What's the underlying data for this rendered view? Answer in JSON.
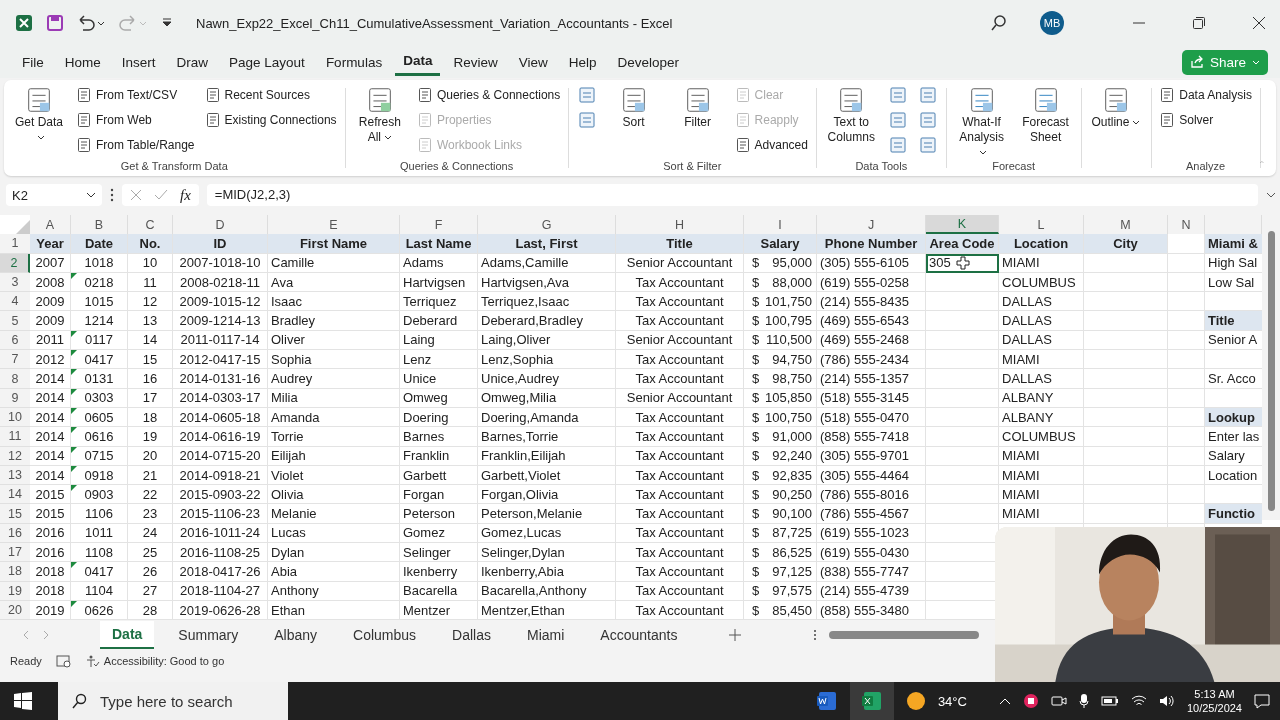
{
  "window": {
    "title": "Nawn_Exp22_Excel_Ch11_CumulativeAssessment_Variation_Accountants  -  Excel",
    "avatar": "MB"
  },
  "menu_tabs": [
    {
      "label": "File",
      "selected": false
    },
    {
      "label": "Home",
      "selected": false
    },
    {
      "label": "Insert",
      "selected": false
    },
    {
      "label": "Draw",
      "selected": false
    },
    {
      "label": "Page Layout",
      "selected": false
    },
    {
      "label": "Formulas",
      "selected": false
    },
    {
      "label": "Data",
      "selected": true
    },
    {
      "label": "Review",
      "selected": false
    },
    {
      "label": "View",
      "selected": false
    },
    {
      "label": "Help",
      "selected": false
    },
    {
      "label": "Developer",
      "selected": false
    }
  ],
  "share_button": "Share",
  "ribbon": [
    {
      "label": "Get & Transform Data",
      "items": [
        {
          "kind": "large",
          "label": "Get Data",
          "dropdown": true,
          "disabled": false
        },
        {
          "kind": "small",
          "label": "From Text/CSV",
          "disabled": false
        },
        {
          "kind": "small",
          "label": "From Web",
          "disabled": false
        },
        {
          "kind": "small",
          "label": "From Table/Range",
          "disabled": false
        },
        {
          "kind": "small",
          "label": "Recent Sources",
          "disabled": false
        },
        {
          "kind": "small",
          "label": "Existing Connections",
          "disabled": false
        }
      ]
    },
    {
      "label": "Queries & Connections",
      "items": [
        {
          "kind": "large",
          "label": "Refresh All",
          "dropdown": true,
          "disabled": false
        },
        {
          "kind": "small",
          "label": "Queries & Connections",
          "disabled": false
        },
        {
          "kind": "small",
          "label": "Properties",
          "disabled": true
        },
        {
          "kind": "small",
          "label": "Workbook Links",
          "disabled": true
        }
      ]
    },
    {
      "label": "Sort & Filter",
      "items": [
        {
          "kind": "icon",
          "disabled": false
        },
        {
          "kind": "icon",
          "disabled": false
        },
        {
          "kind": "large",
          "label": "Sort",
          "dropdown": false,
          "disabled": false
        },
        {
          "kind": "large",
          "label": "Filter",
          "dropdown": false,
          "disabled": false
        },
        {
          "kind": "small",
          "label": "Clear",
          "disabled": true
        },
        {
          "kind": "small",
          "label": "Reapply",
          "disabled": true
        },
        {
          "kind": "small",
          "label": "Advanced",
          "disabled": false
        }
      ]
    },
    {
      "label": "Data Tools",
      "items": [
        {
          "kind": "large",
          "label": "Text to Columns",
          "dropdown": false,
          "disabled": false
        },
        {
          "kind": "icon",
          "disabled": false
        },
        {
          "kind": "icon",
          "disabled": false
        },
        {
          "kind": "icon",
          "disabled": false
        },
        {
          "kind": "icon",
          "disabled": false
        },
        {
          "kind": "icon",
          "disabled": false
        },
        {
          "kind": "icon",
          "disabled": false
        }
      ]
    },
    {
      "label": "Forecast",
      "items": [
        {
          "kind": "large",
          "label": "What-If Analysis",
          "dropdown": true,
          "disabled": false
        },
        {
          "kind": "large",
          "label": "Forecast Sheet",
          "dropdown": false,
          "disabled": false
        }
      ]
    },
    {
      "items": [
        {
          "kind": "large",
          "label": "Outline",
          "dropdown": true,
          "disabled": false
        }
      ]
    },
    {
      "label": "Analyze",
      "items": [
        {
          "kind": "small",
          "label": "Data Analysis",
          "disabled": false
        },
        {
          "kind": "small",
          "label": "Solver",
          "disabled": false
        }
      ]
    }
  ],
  "formula_bar": {
    "name_box": "K2",
    "function_label": "fx",
    "formula": "=MID(J2,2,3)"
  },
  "columns": [
    {
      "letter": "A",
      "label": "Year",
      "selected": false
    },
    {
      "letter": "B",
      "label": "Date",
      "selected": false
    },
    {
      "letter": "C",
      "label": "No.",
      "selected": false
    },
    {
      "letter": "D",
      "label": "ID",
      "selected": false
    },
    {
      "letter": "E",
      "label": "First Name",
      "selected": false
    },
    {
      "letter": "F",
      "label": "Last Name",
      "selected": false
    },
    {
      "letter": "G",
      "label": "Last, First",
      "selected": false
    },
    {
      "letter": "H",
      "label": "Title",
      "selected": false
    },
    {
      "letter": "I",
      "label": "Salary",
      "selected": false
    },
    {
      "letter": "J",
      "label": "Phone Number",
      "selected": false
    },
    {
      "letter": "K",
      "label": "Area Code",
      "selected": true
    },
    {
      "letter": "L",
      "label": "Location",
      "selected": false
    },
    {
      "letter": "M",
      "label": "City",
      "selected": false
    },
    {
      "letter": "N",
      "selected": false
    }
  ],
  "header_row": "1",
  "header_side": "Miami &",
  "rows": [
    {
      "num": "2",
      "selected": true,
      "flag": false,
      "year": "2007",
      "date": "1018",
      "no": "10",
      "id": "2007-1018-10",
      "first": "Camille",
      "last": "Adams",
      "lastfirst": "Adams,Camille",
      "title": "Senior Accountant",
      "currency": "$",
      "salary": "95,000",
      "phone": "(305) 555-6105",
      "area": "305",
      "location": "MIAMI",
      "side": {
        "kind": "text",
        "text": "High Sal"
      }
    },
    {
      "num": "3",
      "selected": false,
      "flag": true,
      "year": "2008",
      "date": "0218",
      "no": "11",
      "id": "2008-0218-11",
      "first": "Ava",
      "last": "Hartvigsen",
      "lastfirst": "Hartvigsen,Ava",
      "title": "Tax Accountant",
      "currency": "$",
      "salary": "88,000",
      "phone": "(619) 555-0258",
      "location": "COLUMBUS",
      "side": {
        "kind": "text",
        "text": "Low Sal"
      }
    },
    {
      "num": "4",
      "selected": false,
      "flag": false,
      "year": "2009",
      "date": "1015",
      "no": "12",
      "id": "2009-1015-12",
      "first": "Isaac",
      "last": "Terriquez",
      "lastfirst": "Terriquez,Isaac",
      "title": "Tax Accountant",
      "currency": "$",
      "salary": "101,750",
      "phone": "(214) 555-8435",
      "location": "DALLAS"
    },
    {
      "num": "5",
      "selected": false,
      "flag": false,
      "year": "2009",
      "date": "1214",
      "no": "13",
      "id": "2009-1214-13",
      "first": "Bradley",
      "last": "Deberard",
      "lastfirst": "Deberard,Bradley",
      "title": "Tax Accountant",
      "currency": "$",
      "salary": "100,795",
      "phone": "(469) 555-6543",
      "location": "DALLAS",
      "side": {
        "kind": "heading",
        "text": "Title"
      }
    },
    {
      "num": "6",
      "selected": false,
      "flag": true,
      "year": "2011",
      "date": "0117",
      "no": "14",
      "id": "2011-0117-14",
      "first": "Oliver",
      "last": "Laing",
      "lastfirst": "Laing,Oliver",
      "title": "Senior Accountant",
      "currency": "$",
      "salary": "110,500",
      "phone": "(469) 555-2468",
      "location": "DALLAS",
      "side": {
        "kind": "text",
        "text": "Senior A"
      }
    },
    {
      "num": "7",
      "selected": false,
      "flag": true,
      "year": "2012",
      "date": "0417",
      "no": "15",
      "id": "2012-0417-15",
      "first": "Sophia",
      "last": "Lenz",
      "lastfirst": "Lenz,Sophia",
      "title": "Tax Accountant",
      "currency": "$",
      "salary": "94,750",
      "phone": "(786) 555-2434",
      "location": "MIAMI"
    },
    {
      "num": "8",
      "selected": false,
      "flag": true,
      "year": "2014",
      "date": "0131",
      "no": "16",
      "id": "2014-0131-16",
      "first": "Audrey",
      "last": "Unice",
      "lastfirst": "Unice,Audrey",
      "title": "Tax Accountant",
      "currency": "$",
      "salary": "98,750",
      "phone": "(214) 555-1357",
      "location": "DALLAS",
      "side": {
        "kind": "text",
        "text": "Sr. Acco"
      }
    },
    {
      "num": "9",
      "selected": false,
      "flag": true,
      "year": "2014",
      "date": "0303",
      "no": "17",
      "id": "2014-0303-17",
      "first": "Milia",
      "last": "Omweg",
      "lastfirst": "Omweg,Milia",
      "title": "Senior Accountant",
      "currency": "$",
      "salary": "105,850",
      "phone": "(518) 555-3145",
      "location": "ALBANY"
    },
    {
      "num": "10",
      "selected": false,
      "flag": true,
      "year": "2014",
      "date": "0605",
      "no": "18",
      "id": "2014-0605-18",
      "first": "Amanda",
      "last": "Doering",
      "lastfirst": "Doering,Amanda",
      "title": "Tax Accountant",
      "currency": "$",
      "salary": "100,750",
      "phone": "(518) 555-0470",
      "location": "ALBANY",
      "side": {
        "kind": "heading",
        "text": "Lookup"
      }
    },
    {
      "num": "11",
      "selected": false,
      "flag": true,
      "year": "2014",
      "date": "0616",
      "no": "19",
      "id": "2014-0616-19",
      "first": "Torrie",
      "last": "Barnes",
      "lastfirst": "Barnes,Torrie",
      "title": "Tax Accountant",
      "currency": "$",
      "salary": "91,000",
      "phone": "(858) 555-7418",
      "location": "COLUMBUS",
      "side": {
        "kind": "text",
        "text": "Enter las"
      }
    },
    {
      "num": "12",
      "selected": false,
      "flag": true,
      "year": "2014",
      "date": "0715",
      "no": "20",
      "id": "2014-0715-20",
      "first": "Eilijah",
      "last": "Franklin",
      "lastfirst": "Franklin,Eilijah",
      "title": "Tax Accountant",
      "currency": "$",
      "salary": "92,240",
      "phone": "(305) 555-9701",
      "location": "MIAMI",
      "side": {
        "kind": "text",
        "text": "Salary"
      }
    },
    {
      "num": "13",
      "selected": false,
      "flag": true,
      "year": "2014",
      "date": "0918",
      "no": "21",
      "id": "2014-0918-21",
      "first": "Violet",
      "last": "Garbett",
      "lastfirst": "Garbett,Violet",
      "title": "Tax Accountant",
      "currency": "$",
      "salary": "92,835",
      "phone": "(305) 555-4464",
      "location": "MIAMI",
      "side": {
        "kind": "text",
        "text": "Location"
      }
    },
    {
      "num": "14",
      "selected": false,
      "flag": true,
      "year": "2015",
      "date": "0903",
      "no": "22",
      "id": "2015-0903-22",
      "first": "Olivia",
      "last": "Forgan",
      "lastfirst": "Forgan,Olivia",
      "title": "Tax Accountant",
      "currency": "$",
      "salary": "90,250",
      "phone": "(786) 555-8016",
      "location": "MIAMI"
    },
    {
      "num": "15",
      "selected": false,
      "flag": false,
      "year": "2015",
      "date": "1106",
      "no": "23",
      "id": "2015-1106-23",
      "first": "Melanie",
      "last": "Peterson",
      "lastfirst": "Peterson,Melanie",
      "title": "Tax Accountant",
      "currency": "$",
      "salary": "90,100",
      "phone": "(786) 555-4567",
      "location": "MIAMI",
      "side": {
        "kind": "heading",
        "text": "Functio"
      }
    },
    {
      "num": "16",
      "selected": false,
      "flag": false,
      "year": "2016",
      "date": "1011",
      "no": "24",
      "id": "2016-1011-24",
      "first": "Lucas",
      "last": "Gomez",
      "lastfirst": "Gomez,Lucas",
      "title": "Tax Accountant",
      "currency": "$",
      "salary": "87,725",
      "phone": "(619) 555-1023"
    },
    {
      "num": "17",
      "selected": false,
      "flag": false,
      "year": "2016",
      "date": "1108",
      "no": "25",
      "id": "2016-1108-25",
      "first": "Dylan",
      "last": "Selinger",
      "lastfirst": "Selinger,Dylan",
      "title": "Tax Accountant",
      "currency": "$",
      "salary": "86,525",
      "phone": "(619) 555-0430"
    },
    {
      "num": "18",
      "selected": false,
      "flag": true,
      "year": "2018",
      "date": "0417",
      "no": "26",
      "id": "2018-0417-26",
      "first": "Abia",
      "last": "Ikenberry",
      "lastfirst": "Ikenberry,Abia",
      "title": "Tax Accountant",
      "currency": "$",
      "salary": "97,125",
      "phone": "(838) 555-7747"
    },
    {
      "num": "19",
      "selected": false,
      "flag": false,
      "year": "2018",
      "date": "1104",
      "no": "27",
      "id": "2018-1104-27",
      "first": "Anthony",
      "last": "Bacarella",
      "lastfirst": "Bacarella,Anthony",
      "title": "Tax Accountant",
      "currency": "$",
      "salary": "97,575",
      "phone": "(214) 555-4739"
    },
    {
      "num": "20",
      "selected": false,
      "flag": true,
      "year": "2019",
      "date": "0626",
      "no": "28",
      "id": "2019-0626-28",
      "first": "Ethan",
      "last": "Mentzer",
      "lastfirst": "Mentzer,Ethan",
      "title": "Tax Accountant",
      "currency": "$",
      "salary": "85,450",
      "phone": "(858) 555-3480"
    }
  ],
  "sheet_tabs": [
    {
      "label": "Data",
      "selected": true
    },
    {
      "label": "Summary",
      "selected": false
    },
    {
      "label": "Albany",
      "selected": false
    },
    {
      "label": "Columbus",
      "selected": false
    },
    {
      "label": "Dallas",
      "selected": false
    },
    {
      "label": "Miami",
      "selected": false
    },
    {
      "label": "Accountants",
      "selected": false
    }
  ],
  "status_bar": {
    "mode": "Ready",
    "accessibility": "Accessibility: Good to go"
  },
  "taskbar": {
    "search_placeholder": "Type here to search",
    "temperature": "34°C",
    "time": "5:13 AM",
    "date": "10/25/2024"
  }
}
